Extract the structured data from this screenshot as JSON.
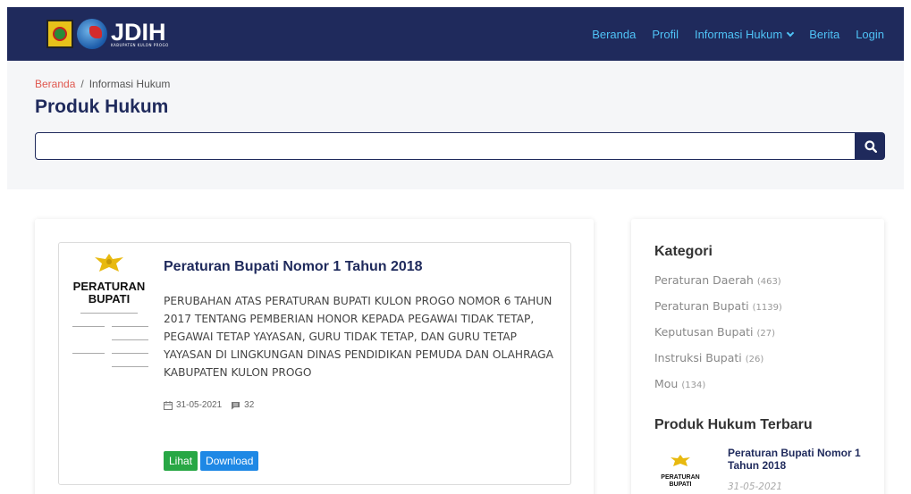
{
  "brand": {
    "name": "JDIH",
    "subtitle": "KABUPATEN KULON PROGO"
  },
  "nav": {
    "items": [
      {
        "label": "Beranda"
      },
      {
        "label": "Profil"
      },
      {
        "label": "Informasi Hukum"
      },
      {
        "label": "Berita"
      },
      {
        "label": "Login"
      }
    ]
  },
  "breadcrumb": {
    "home": "Beranda",
    "separator": "/",
    "current": "Informasi Hukum"
  },
  "page": {
    "title": "Produk Hukum"
  },
  "search": {
    "value": "",
    "placeholder": ""
  },
  "product": {
    "thumb_title_line1": "PERATURAN",
    "thumb_title_line2": "BUPATI",
    "title": "Peraturan Bupati Nomor 1 Tahun 2018",
    "description": "PERUBAHAN ATAS PERATURAN BUPATI KULON PROGO NOMOR 6 TAHUN 2017 TENTANG PEMBERIAN HONOR KEPADA PEGAWAI TIDAK TETAP, PEGAWAI TETAP YAYASAN, GURU TIDAK TETAP, DAN GURU TETAP YAYASAN DI LINGKUNGAN DINAS PENDIDIKAN PEMUDA DAN OLAHRAGA KABUPATEN KULON PROGO",
    "date": "31-05-2021",
    "comments": "32",
    "view_label": "Lihat",
    "download_label": "Download"
  },
  "sidebar": {
    "category_heading": "Kategori",
    "categories": [
      {
        "label": "Peraturan Daerah",
        "count": "(463)"
      },
      {
        "label": "Peraturan Bupati",
        "count": "(1139)"
      },
      {
        "label": "Keputusan Bupati",
        "count": "(27)"
      },
      {
        "label": "Instruksi Bupati",
        "count": "(26)"
      },
      {
        "label": "Mou",
        "count": "(134)"
      }
    ],
    "latest_heading": "Produk Hukum Terbaru",
    "latest": {
      "thumb_line1": "PERATURAN",
      "thumb_line2": "BUPATI",
      "title": "Peraturan Bupati Nomor 1 Tahun 2018",
      "date": "31-05-2021"
    }
  },
  "colors": {
    "navbar": "#1f2a5c",
    "nav_link": "#4fc3f7",
    "accent_red": "#e0584f",
    "title_navy": "#1f2a5c",
    "btn_green": "#28a745",
    "btn_blue": "#1e88e5"
  }
}
